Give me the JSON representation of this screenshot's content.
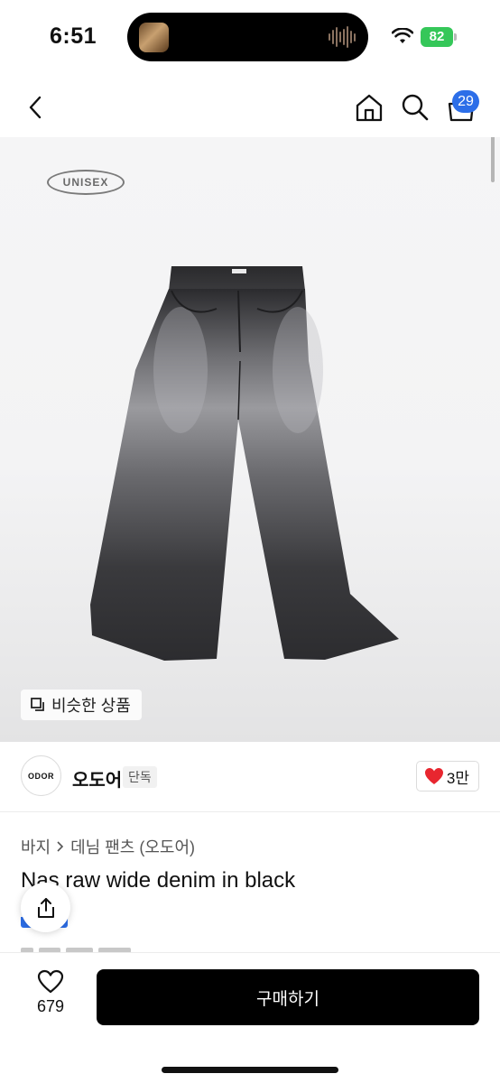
{
  "status_bar": {
    "time": "6:51",
    "battery": "82"
  },
  "nav": {
    "cart_count": "29",
    "icons": [
      "back-icon",
      "home-icon",
      "search-icon",
      "cart-icon"
    ]
  },
  "hero": {
    "logo_text": "UNISEX",
    "similar_button": "비슷한 상품"
  },
  "brand": {
    "logo_text": "ODOR",
    "name": "오도어",
    "badge": "단독",
    "likes": "3만"
  },
  "product": {
    "breadcrumb": [
      "바지",
      "데님 팬츠 (오도어)"
    ],
    "title": "Nas raw wide denim in black"
  },
  "bottom_bar": {
    "wish_count": "679",
    "buy_label": "구매하기"
  },
  "colors": {
    "accent": "#2c6ee8",
    "heart": "#e8262f",
    "battery": "#35c759",
    "buy_button": "#000000"
  }
}
